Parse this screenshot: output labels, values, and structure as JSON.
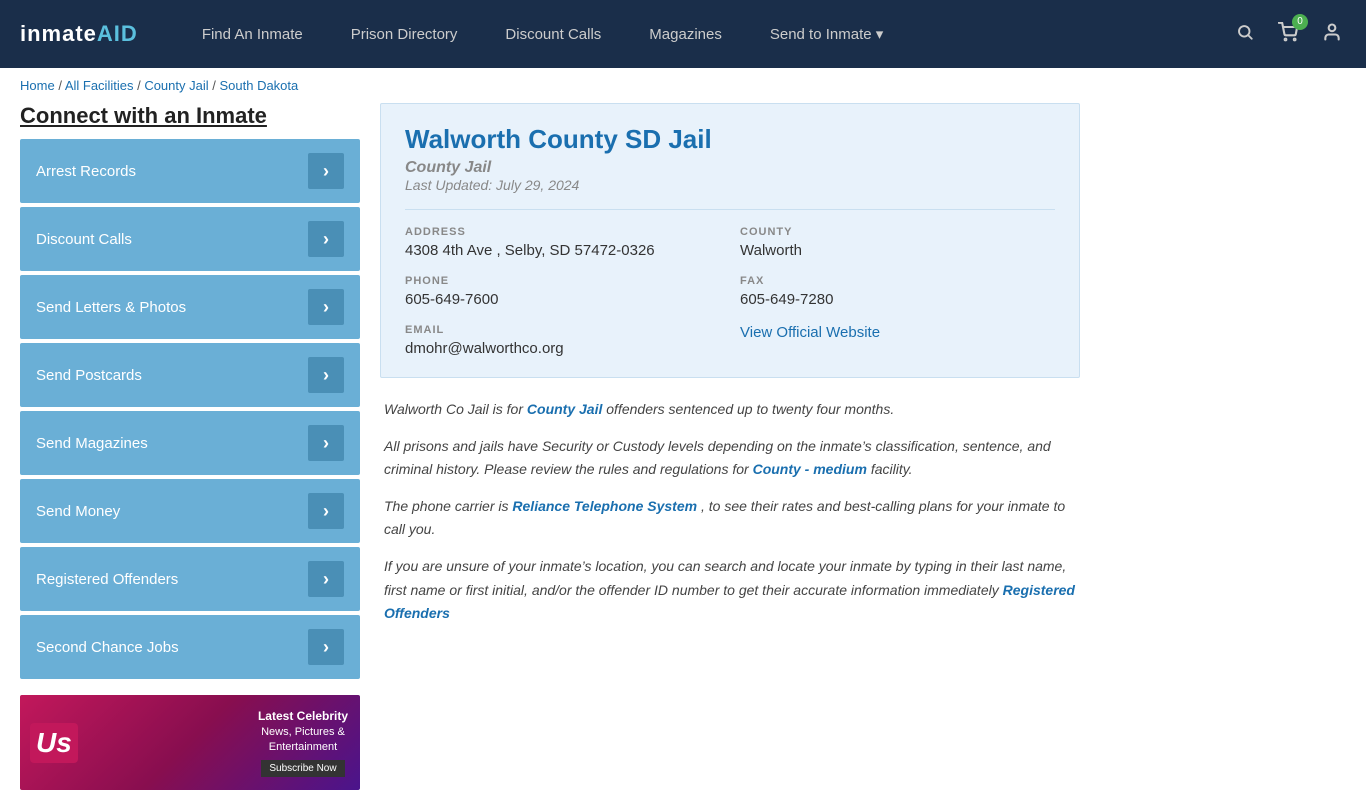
{
  "nav": {
    "logo": "inmateAID",
    "links": [
      {
        "label": "Find An Inmate",
        "name": "find-inmate"
      },
      {
        "label": "Prison Directory",
        "name": "prison-directory"
      },
      {
        "label": "Discount Calls",
        "name": "discount-calls"
      },
      {
        "label": "Magazines",
        "name": "magazines"
      },
      {
        "label": "Send to Inmate ▾",
        "name": "send-to-inmate"
      }
    ],
    "cart_count": "0"
  },
  "breadcrumb": {
    "items": [
      {
        "label": "Home",
        "href": "#"
      },
      {
        "label": "All Facilities",
        "href": "#"
      },
      {
        "label": "County Jail",
        "href": "#"
      },
      {
        "label": "South Dakota",
        "href": "#"
      }
    ]
  },
  "sidebar": {
    "title": "Connect with an Inmate",
    "menu": [
      "Arrest Records",
      "Discount Calls",
      "Send Letters & Photos",
      "Send Postcards",
      "Send Magazines",
      "Send Money",
      "Registered Offenders",
      "Second Chance Jobs"
    ]
  },
  "ad": {
    "logo": "Us",
    "title": "Latest Celebrity",
    "line2": "News, Pictures &",
    "line3": "Entertainment",
    "button": "Subscribe Now"
  },
  "facility": {
    "name": "Walworth County SD Jail",
    "type": "County Jail",
    "last_updated": "Last Updated: July 29, 2024",
    "address_label": "ADDRESS",
    "address": "4308 4th Ave , Selby, SD 57472-0326",
    "county_label": "COUNTY",
    "county": "Walworth",
    "phone_label": "PHONE",
    "phone": "605-649-7600",
    "fax_label": "FAX",
    "fax": "605-649-7280",
    "email_label": "EMAIL",
    "email": "dmohr@walworthco.org",
    "website_label": "View Official Website",
    "website_href": "#"
  },
  "descriptions": [
    {
      "id": "desc1",
      "text_before": "Walworth Co Jail is for ",
      "bold_link": "County Jail",
      "text_after": " offenders sentenced up to twenty four months."
    },
    {
      "id": "desc2",
      "text_before": "All prisons and jails have Security or Custody levels depending on the inmate’s classification, sentence, and criminal history. Please review the rules and regulations for ",
      "bold_link": "County - medium",
      "text_after": " facility."
    },
    {
      "id": "desc3",
      "text_before": "The phone carrier is ",
      "bold_link": "Reliance Telephone System",
      "text_after": ", to see their rates and best-calling plans for your inmate to call you."
    },
    {
      "id": "desc4",
      "text_before": "If you are unsure of your inmate’s location, you can search and locate your inmate by typing in their last name, first name or first initial, and/or the offender ID number to get their accurate information immediately ",
      "bold_link": "Registered Offenders",
      "text_after": ""
    }
  ]
}
